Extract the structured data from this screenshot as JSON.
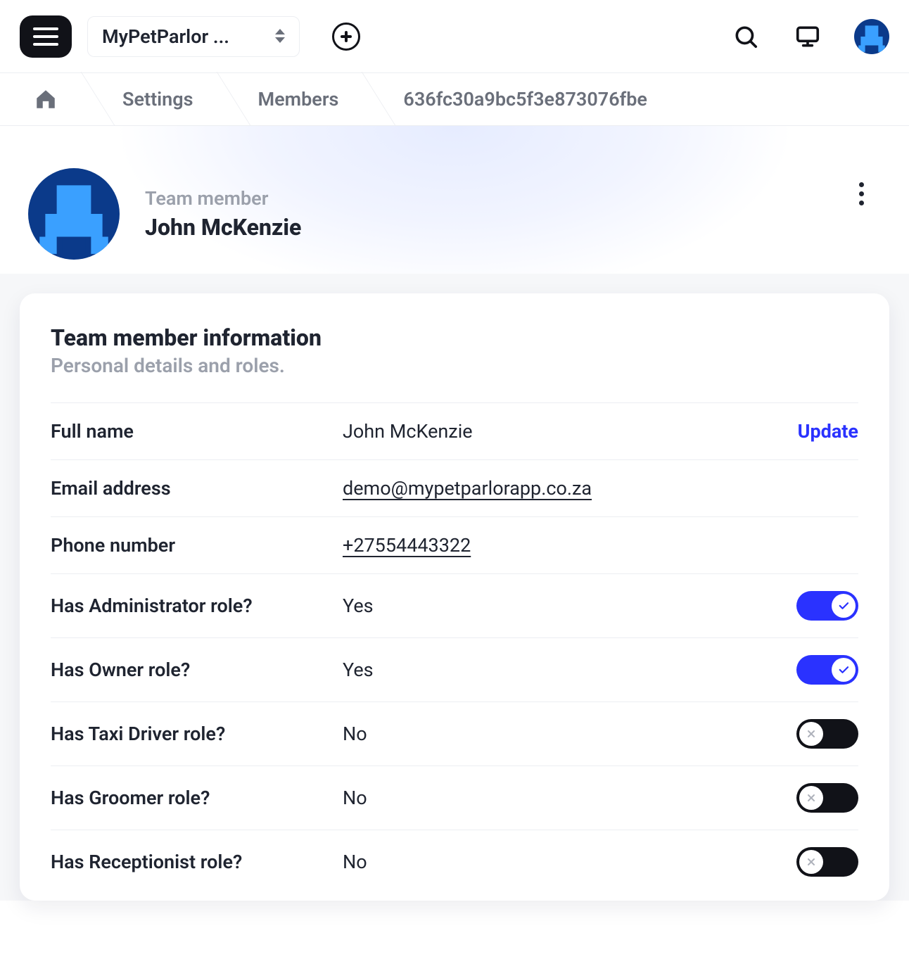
{
  "header": {
    "workspace_label": "MyPetParlor ..."
  },
  "breadcrumbs": {
    "settings": "Settings",
    "members": "Members",
    "id": "636fc30a9bc5f3e873076fbe"
  },
  "hero": {
    "eyebrow": "Team member",
    "name": "John McKenzie"
  },
  "card": {
    "title": "Team member information",
    "subtitle": "Personal details and roles.",
    "update_label": "Update",
    "rows": {
      "full_name": {
        "label": "Full name",
        "value": "John McKenzie"
      },
      "email": {
        "label": "Email address",
        "value": "demo@mypetparlorapp.co.za"
      },
      "phone": {
        "label": "Phone number",
        "value": "+27554443322"
      },
      "admin": {
        "label": "Has Administrator role?",
        "value": "Yes",
        "on": true
      },
      "owner": {
        "label": "Has Owner role?",
        "value": "Yes",
        "on": true
      },
      "taxi": {
        "label": "Has Taxi Driver role?",
        "value": "No",
        "on": false
      },
      "groomer": {
        "label": "Has Groomer role?",
        "value": "No",
        "on": false
      },
      "receptionist": {
        "label": "Has Receptionist role?",
        "value": "No",
        "on": false
      }
    }
  }
}
